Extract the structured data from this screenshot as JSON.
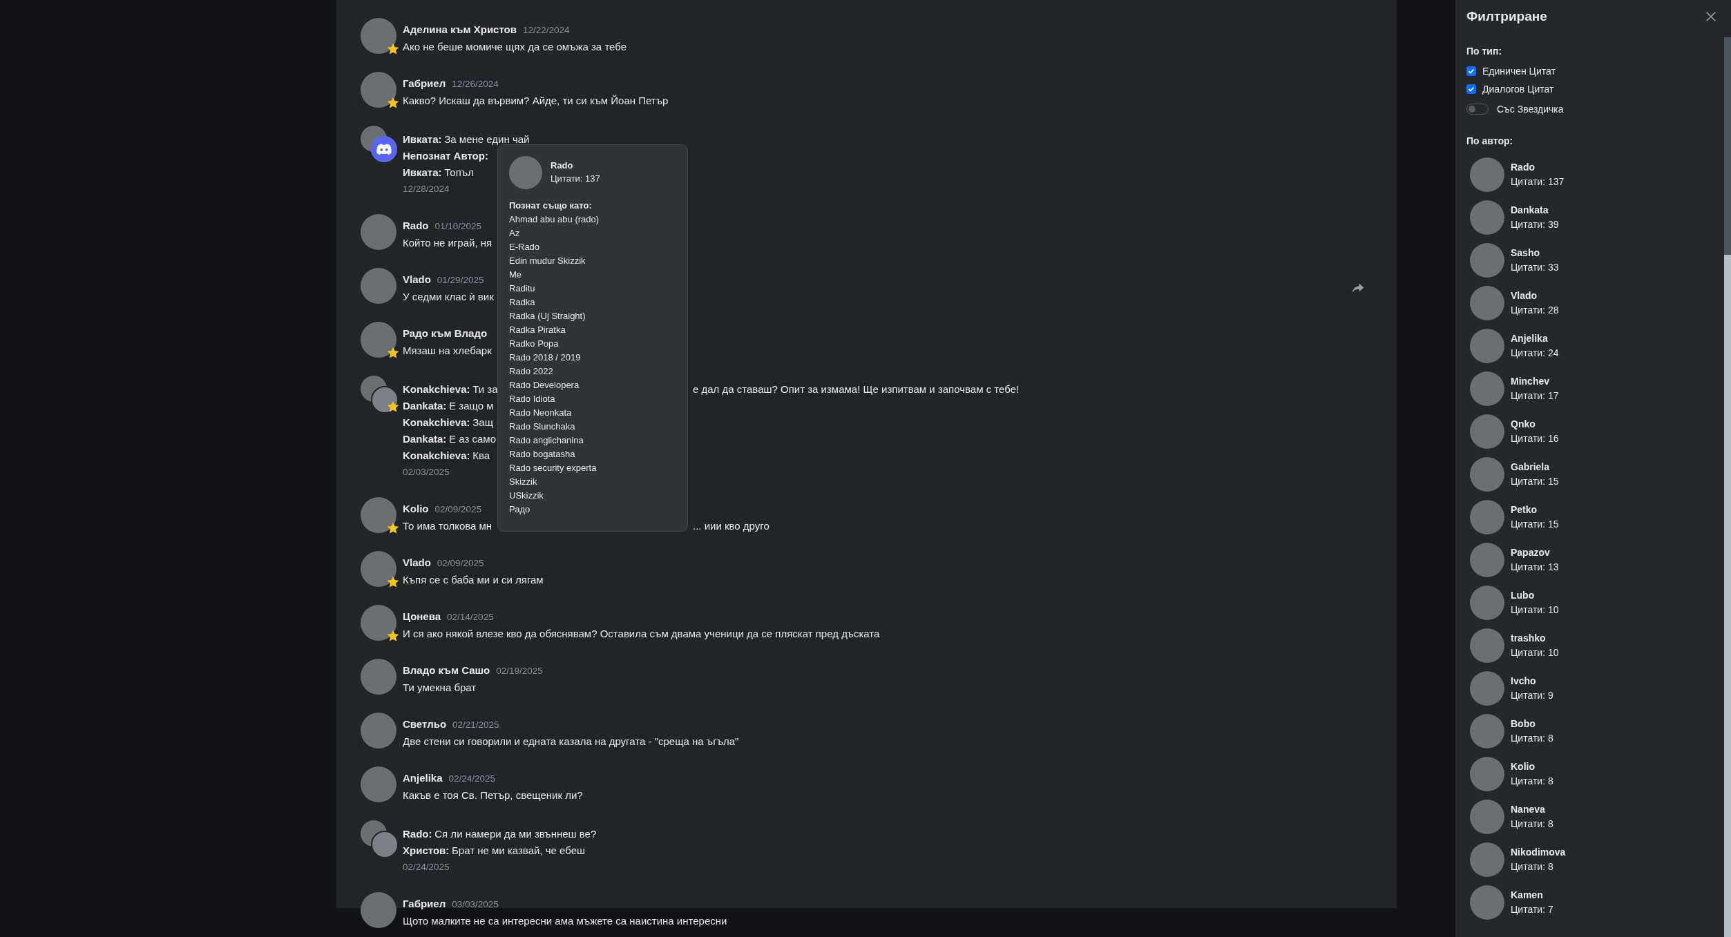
{
  "messages": [
    {
      "kind": "single",
      "author": "Аделина към Христов",
      "date": "12/22/2024",
      "text": "Ако не беше момиче щях да се омъжа за тебе",
      "starred": true,
      "hovered": false
    },
    {
      "kind": "single",
      "author": "Габриел",
      "date": "12/26/2024",
      "text": "Какво? Искаш да вървим? Айде, ти си към Йоан Петър",
      "starred": true,
      "hovered": false
    },
    {
      "kind": "dialog",
      "lines": [
        {
          "speaker": "Ивката:",
          "text": "За мене един чай"
        },
        {
          "speaker": "Непознат Автор:"
        },
        {
          "speaker": "Ивката:",
          "text": "Топъл"
        }
      ],
      "date": "12/28/2024",
      "starred": false,
      "unknown_second": true
    },
    {
      "kind": "single",
      "author": "Rado",
      "date": "01/10/2025",
      "text": "Който не играй, ня",
      "starred": false,
      "hovered": false
    },
    {
      "kind": "single",
      "author": "Vlado",
      "date": "01/29/2025",
      "text": "У седми клас ѝ вик",
      "starred": false,
      "hovered": true
    },
    {
      "kind": "single",
      "author": "Радо към Владо",
      "text": "Мязаш на хлебарк",
      "starred": true,
      "hovered": false
    },
    {
      "kind": "dialog",
      "lines": [
        {
          "speaker": "Konakchieva:",
          "text": "Ти за",
          "text_after": "е дал да ставаш? Опит за измама! Ще изпитвам и започвам с тебе!"
        },
        {
          "speaker": "Dankata:",
          "text": "Е защо м"
        },
        {
          "speaker": "Konakchieva:",
          "text": "Защ"
        },
        {
          "speaker": "Dankata:",
          "text": "Е аз само"
        },
        {
          "speaker": "Konakchieva:",
          "text": "Ква"
        }
      ],
      "date": "02/03/2025",
      "starred": true,
      "unknown_second": false
    },
    {
      "kind": "single",
      "author": "Kolio",
      "date": "02/09/2025",
      "text": "То има толкова мн",
      "text_after": "... иии кво друго",
      "starred": true,
      "hovered": false
    },
    {
      "kind": "single",
      "author": "Vlado",
      "date": "02/09/2025",
      "text": "Къпя се с баба ми и си лягам",
      "starred": true,
      "hovered": false
    },
    {
      "kind": "single",
      "author": "Цонева",
      "date": "02/14/2025",
      "text": "И ся ако някой влезе кво да обяснявам? Оставила съм двама ученици да се пляскат пред дъската",
      "starred": true,
      "hovered": false
    },
    {
      "kind": "single",
      "author": "Владо към Сашо",
      "date": "02/19/2025",
      "text": "Ти умекна брат",
      "starred": false,
      "hovered": false
    },
    {
      "kind": "single",
      "author": "Светльо",
      "date": "02/21/2025",
      "text": "Две стени си говорили и едната казала на другата - \"среща на ъгъла\"",
      "starred": false,
      "hovered": false
    },
    {
      "kind": "single",
      "author": "Anjelika",
      "date": "02/24/2025",
      "text": "Какъв е тоя Св. Петър, свещеник ли?",
      "starred": false,
      "hovered": false
    },
    {
      "kind": "dialog",
      "lines": [
        {
          "speaker": "Rado:",
          "text": "Ся ли намери да ми звъннеш ве?"
        },
        {
          "speaker": "Христов:",
          "text": "Брат не ми казвай, че ебеш"
        }
      ],
      "date": "02/24/2025",
      "starred": false,
      "unknown_second": false
    },
    {
      "kind": "single",
      "author": "Габриел",
      "date": "03/03/2025",
      "text": "Щото малките не са интересни ама мъжете са наистина интересни",
      "starred": false,
      "hovered": false
    }
  ],
  "tooltip": {
    "name": "Rado",
    "count": "Цитати: 137",
    "aliases_title": "Познат също като:",
    "aliases": [
      "Ahmad abu abu (rado)",
      "Az",
      "E-Rado",
      "Edin mudur Skizzik",
      "Me",
      "Raditu",
      "Radka",
      "Radka (Uj Straight)",
      "Radka Piratka",
      "Radko Popa",
      "Rado 2018 / 2019",
      "Rado 2022",
      "Rado Developera",
      "Rado Idiota",
      "Rado Neonkata",
      "Rado Slunchaka",
      "Rado anglichanina",
      "Rado bogatasha",
      "Rado security experta",
      "Skizzik",
      "USkizzik",
      "Радо"
    ]
  },
  "sidebar": {
    "title": "Филтриране",
    "type_heading": "По тип:",
    "filters": [
      {
        "kind": "checkbox",
        "label": "Единичен Цитат",
        "checked": true
      },
      {
        "kind": "checkbox",
        "label": "Диалогов Цитат",
        "checked": true
      },
      {
        "kind": "toggle",
        "label": "Със Звездичка",
        "checked": false
      }
    ],
    "author_heading": "По автор:",
    "authors": [
      {
        "name": "Rado",
        "count": "Цитати: 137"
      },
      {
        "name": "Dankata",
        "count": "Цитати: 39"
      },
      {
        "name": "Sasho",
        "count": "Цитати: 33"
      },
      {
        "name": "Vlado",
        "count": "Цитати: 28"
      },
      {
        "name": "Anjelika",
        "count": "Цитати: 24"
      },
      {
        "name": "Minchev",
        "count": "Цитати: 17"
      },
      {
        "name": "Qnko",
        "count": "Цитати: 16"
      },
      {
        "name": "Gabriela",
        "count": "Цитати: 15"
      },
      {
        "name": "Petko",
        "count": "Цитати: 15"
      },
      {
        "name": "Papazov",
        "count": "Цитати: 13"
      },
      {
        "name": "Lubo",
        "count": "Цитати: 10"
      },
      {
        "name": "trashko",
        "count": "Цитати: 10"
      },
      {
        "name": "Ivcho",
        "count": "Цитати: 9"
      },
      {
        "name": "Bobo",
        "count": "Цитати: 8"
      },
      {
        "name": "Kolio",
        "count": "Цитати: 8"
      },
      {
        "name": "Naneva",
        "count": "Цитати: 8"
      },
      {
        "name": "Nikodimova",
        "count": "Цитати: 8"
      },
      {
        "name": "Kamen",
        "count": "Цитати: 7"
      }
    ]
  }
}
